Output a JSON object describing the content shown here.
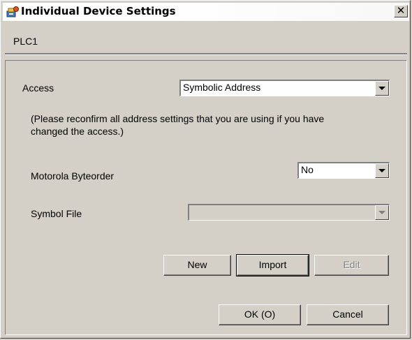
{
  "window": {
    "title": "Individual Device Settings",
    "close_glyph": "✕",
    "icon": "device-settings-icon"
  },
  "device_name": "PLC1",
  "access": {
    "label": "Access",
    "value": "Symbolic Address"
  },
  "note": "(Please reconfirm all address settings that you are using if you have changed the access.)",
  "byteorder": {
    "label": "Motorola Byteorder",
    "value": "No"
  },
  "symbol_file": {
    "label": "Symbol File",
    "value": ""
  },
  "buttons": {
    "new": "New",
    "import": "Import",
    "edit": "Edit",
    "ok": "OK (O)",
    "cancel": "Cancel"
  }
}
